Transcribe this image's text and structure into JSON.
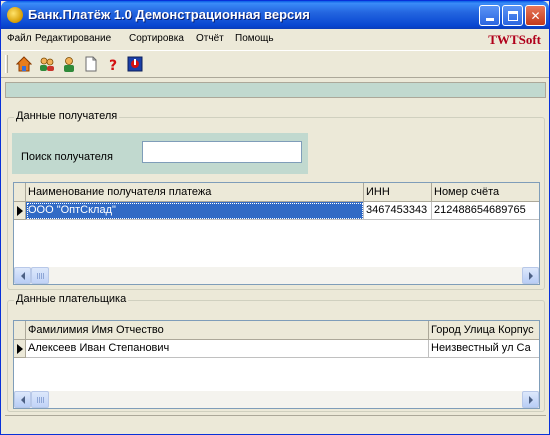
{
  "window": {
    "title": "Банк.Платёж 1.0 Демонстрационная версия"
  },
  "menu": {
    "items": [
      "Файл",
      "Редактирование",
      "Сортировка",
      "Отчёт",
      "Помощь"
    ],
    "brand": "TWTSoft"
  },
  "toolbar": {
    "icons": [
      "home-icon",
      "users-icon",
      "user-icon",
      "document-icon",
      "help-icon",
      "exit-icon"
    ]
  },
  "recipient": {
    "group_title": "Данные получателя",
    "search_label": "Поиск получателя",
    "search_value": "",
    "columns": [
      "Наименование получателя платежа",
      "ИНН",
      "Номер счёта"
    ],
    "rows": [
      {
        "name": "ООО \"ОптСклад\"",
        "inn": "3467453343",
        "account": "212488654689765"
      }
    ]
  },
  "payer": {
    "group_title": "Данные плательщика",
    "columns": [
      "Фамилимия Имя Отчество",
      "Город Улица Корпус"
    ],
    "rows": [
      {
        "fio": "Алексеев Иван Степанович",
        "address": "Неизвестный ул Са"
      }
    ]
  },
  "colors": {
    "selection": "#316ac5",
    "panel": "#c1d9cf",
    "brand": "#b0001a"
  }
}
